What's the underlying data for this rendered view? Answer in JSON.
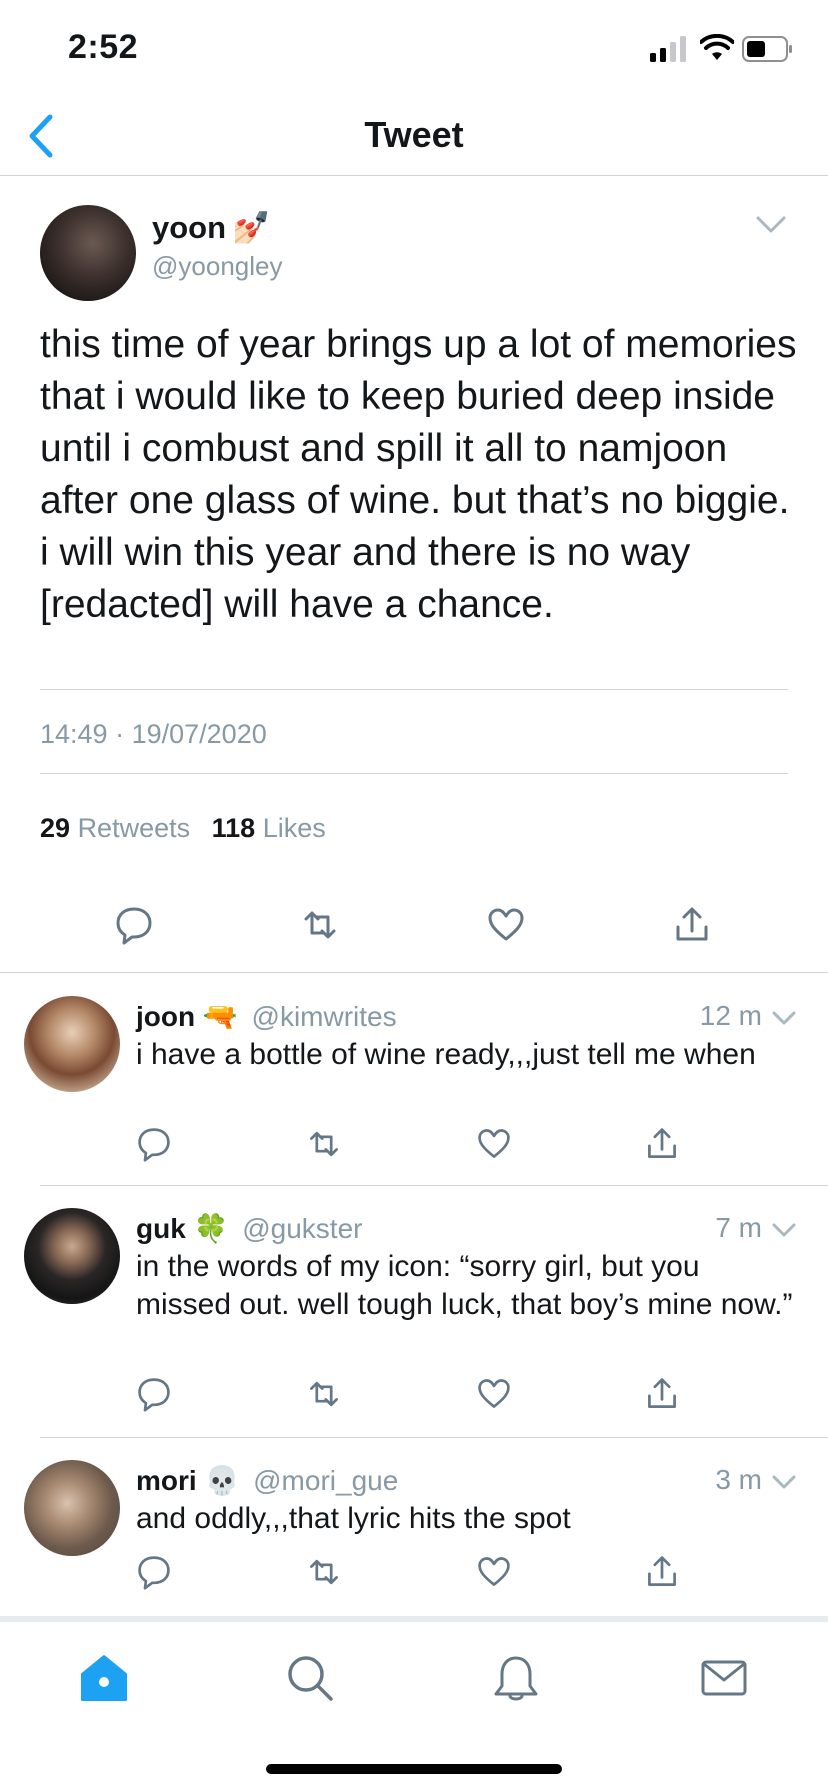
{
  "status_bar": {
    "time": "2:52"
  },
  "nav": {
    "title": "Tweet"
  },
  "main_tweet": {
    "name": "yoon",
    "name_emoji": "💅🏻",
    "handle": "@yoongley",
    "text": "this time of year brings up a lot of memories that i would like to keep buried deep inside until i combust and spill it all to namjoon after one glass of wine. but that’s no biggie. i will win this year and there is no way [redacted] will have a chance.",
    "time": "14:49",
    "date": "19/07/2020",
    "retweets_count": "29",
    "retweets_label": "Retweets",
    "likes_count": "118",
    "likes_label": "Likes"
  },
  "replies": [
    {
      "name": "joon",
      "emoji": "🔫",
      "handle": "@kimwrites",
      "time": "12 m",
      "text": "i have a bottle of wine ready,,,just tell me when"
    },
    {
      "name": "guk",
      "emoji": "🍀",
      "handle": "@gukster",
      "time": "7 m",
      "text": "in the words of my icon: “sorry girl, but you missed out. well tough luck, that boy’s mine now.”"
    },
    {
      "name": "mori",
      "emoji": "💀",
      "handle": "@mori_gue",
      "time": "3 m",
      "text": "and oddly,,,that lyric hits the spot"
    }
  ],
  "icons": {
    "back": "chevron-left-icon",
    "reply": "comment-icon",
    "retweet": "retweet-icon",
    "like": "heart-icon",
    "share": "share-icon",
    "home": "home-icon",
    "search": "search-icon",
    "notifications": "bell-icon",
    "messages": "mail-icon"
  },
  "colors": {
    "accent": "#1da1f2",
    "text": "#14171a",
    "secondary": "#8899a6",
    "divider": "#cfd4d8"
  }
}
